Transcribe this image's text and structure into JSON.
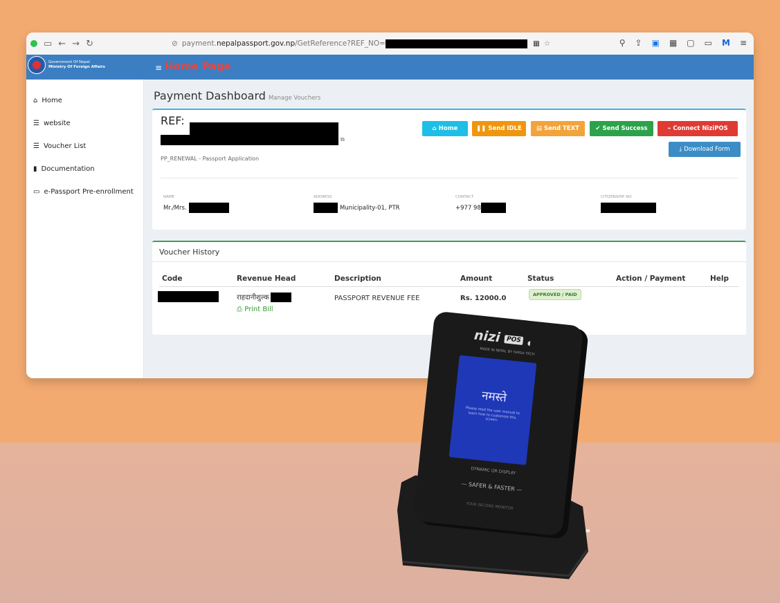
{
  "browser": {
    "url_scheme": "payment.",
    "url_host": "nepalpassport.gov.np",
    "url_path": "/GetReference?REF_NO="
  },
  "header": {
    "logo_line1": "Government Of Nepal",
    "logo_line2": "Ministry Of Foreign Affairs",
    "page_title": "Home Page"
  },
  "sidebar": {
    "items": [
      {
        "label": "Home",
        "icon": "home-icon"
      },
      {
        "label": "website",
        "icon": "list-icon"
      },
      {
        "label": "Voucher List",
        "icon": "list-icon"
      },
      {
        "label": "Documentation",
        "icon": "book-icon"
      },
      {
        "label": "e-Passport Pre-enrollment",
        "icon": "laptop-icon"
      }
    ]
  },
  "dashboard": {
    "title": "Payment Dashboard",
    "subtitle": "Manage Vouchers",
    "ref_label": "REF:",
    "application_type": "PP_RENEWAL - Passport Application",
    "buttons": {
      "home": "Home",
      "send_idle": "Send IDLE",
      "send_text": "Send TEXT",
      "send_success": "Send Success",
      "connect": "Connect NiziPOS",
      "download": "Download Form"
    },
    "info": {
      "name_label": "NAME",
      "name_value": "Mr./Mrs.",
      "address_label": "ADDRESS",
      "address_value": "Municipality-01, PTR",
      "contact_label": "CONTACT",
      "contact_value": "+977 98",
      "citizenship_label": "CITIZENSHIP NO"
    }
  },
  "vouchers": {
    "title": "Voucher History",
    "columns": [
      "Code",
      "Revenue Head",
      "Description",
      "Amount",
      "Status",
      "Action / Payment",
      "Help"
    ],
    "row": {
      "revenue_head": "राहदानीशुल्क",
      "print_bill": "Print Bill",
      "description": "PASSPORT REVENUE FEE",
      "amount": "Rs. 12000.0",
      "status": "APPROVED / PAID"
    }
  },
  "device": {
    "brand": "nizi",
    "brand_tag": "POS",
    "made_in": "MADE IN NEPAL BY YARSA TECH",
    "greeting": "नमस्ते",
    "screen_msg": "Please read the user manual to learn how to customize this screen.",
    "feature": "DYNAMIC QR DISPLAY",
    "slogan": "SAFER & FASTER",
    "tagline": "YOUR SECOND MONITOR"
  },
  "colors": {
    "background": "#f3aa71",
    "topbar": "#3c7ec2",
    "home_title": "#e7463f",
    "btn_home": "#1ebfe6",
    "btn_idle": "#f0960d",
    "btn_text": "#f2a33a",
    "btn_success": "#2ca24a",
    "btn_connect": "#df3b33",
    "btn_download": "#3c8dc6"
  }
}
